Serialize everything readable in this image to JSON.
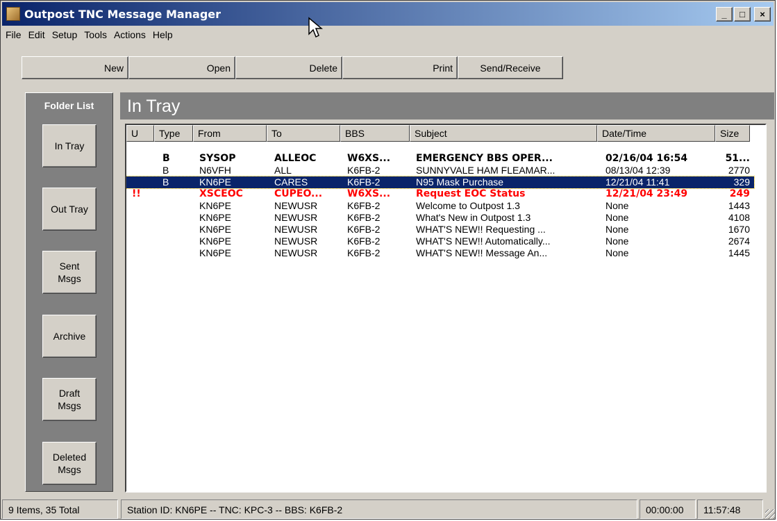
{
  "window": {
    "title": "Outpost TNC Message Manager",
    "controls": [
      "_",
      "□",
      "×"
    ]
  },
  "menu": [
    "File",
    "Edit",
    "Setup",
    "Tools",
    "Actions",
    "Help"
  ],
  "toolbar": {
    "new": "New",
    "open": "Open",
    "delete": "Delete",
    "print": "Print",
    "send_receive": "Send/Receive"
  },
  "folders": {
    "title": "Folder List",
    "items": [
      "In Tray",
      "Out Tray",
      "Sent\nMsgs",
      "Archive",
      "Draft\nMsgs",
      "Deleted\nMsgs"
    ]
  },
  "main": {
    "header": "In Tray"
  },
  "columns": [
    "U",
    "Type",
    "From",
    "To",
    "BBS",
    "Subject",
    "Date/Time",
    "Size"
  ],
  "messages": [
    {
      "u": "",
      "type": "B",
      "from": "SYSOP",
      "to": "ALLEOC",
      "bbs": "W6XS...",
      "subject": "EMERGENCY BBS OPER...",
      "date": "02/16/04 16:54",
      "size": "51..."
    },
    {
      "u": "",
      "type": "B",
      "from": "N6VFH",
      "to": "ALL",
      "bbs": "K6FB-2",
      "subject": "SUNNYVALE HAM FLEAMAR...",
      "date": "08/13/04 12:39",
      "size": "2770"
    },
    {
      "u": "",
      "type": "B",
      "from": "KN6PE",
      "to": "CARES",
      "bbs": "K6FB-2",
      "subject": "N95 Mask Purchase",
      "date": "12/21/04 11:41",
      "size": "329"
    },
    {
      "u": "!!",
      "type": "",
      "from": "XSCEOC",
      "to": "CUPEO...",
      "bbs": "W6XS...",
      "subject": "Request EOC Status",
      "date": "12/21/04 23:49",
      "size": "249"
    },
    {
      "u": "",
      "type": "",
      "from": "KN6PE",
      "to": "NEWUSR",
      "bbs": "K6FB-2",
      "subject": "Welcome to Outpost 1.3",
      "date": "None",
      "size": "1443"
    },
    {
      "u": "",
      "type": "",
      "from": "KN6PE",
      "to": "NEWUSR",
      "bbs": "K6FB-2",
      "subject": "What's New in Outpost 1.3",
      "date": "None",
      "size": "4108"
    },
    {
      "u": "",
      "type": "",
      "from": "KN6PE",
      "to": "NEWUSR",
      "bbs": "K6FB-2",
      "subject": "WHAT'S NEW!!  Requesting ...",
      "date": "None",
      "size": "1670"
    },
    {
      "u": "",
      "type": "",
      "from": "KN6PE",
      "to": "NEWUSR",
      "bbs": "K6FB-2",
      "subject": "WHAT'S NEW!!  Automatically...",
      "date": "None",
      "size": "2674"
    },
    {
      "u": "",
      "type": "",
      "from": "KN6PE",
      "to": "NEWUSR",
      "bbs": "K6FB-2",
      "subject": "WHAT'S NEW!!  Message An...",
      "date": "None",
      "size": "1445"
    }
  ],
  "status": {
    "count": "9 Items, 35 Total",
    "station": "Station ID: KN6PE  --  TNC: KPC-3  --  BBS: K6FB-2",
    "timer": "00:00:00",
    "clock": "11:57:48"
  },
  "colors": {
    "titlebar": "#0a246a",
    "selection": "#0a246a",
    "urgent": "#ff0000",
    "panel": "#808080"
  }
}
